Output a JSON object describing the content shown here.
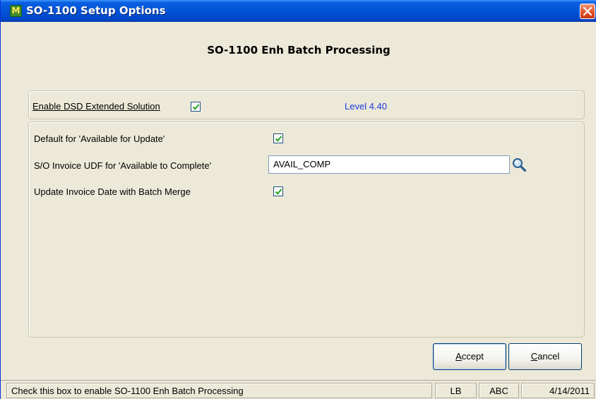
{
  "window": {
    "title": "SO-1100 Setup Options",
    "icon": "mas-app-icon",
    "icon_text": "M"
  },
  "heading": "SO-1100 Enh Batch Processing",
  "top_panel": {
    "enable_label": "Enable DSD Extended Solution",
    "enable_checked": true,
    "level_text": "Level  4.40"
  },
  "options": {
    "default_available_label": "Default for 'Available for Update'",
    "default_available_checked": true,
    "udf_label": "S/O Invoice UDF for 'Available to Complete'",
    "udf_value": "AVAIL_COMP",
    "update_date_label": "Update Invoice Date with Batch Merge",
    "update_date_checked": true
  },
  "buttons": {
    "accept_label": "Accept",
    "cancel_label": "Cancel"
  },
  "statusbar": {
    "message": "Check this box to enable SO-1100 Enh Batch Processing",
    "user": "LB",
    "company": "ABC",
    "date": "4/14/2011"
  },
  "colors": {
    "title_bar": "#0253d8",
    "level_text": "#1c3be0",
    "checkmark": "#21a121"
  }
}
